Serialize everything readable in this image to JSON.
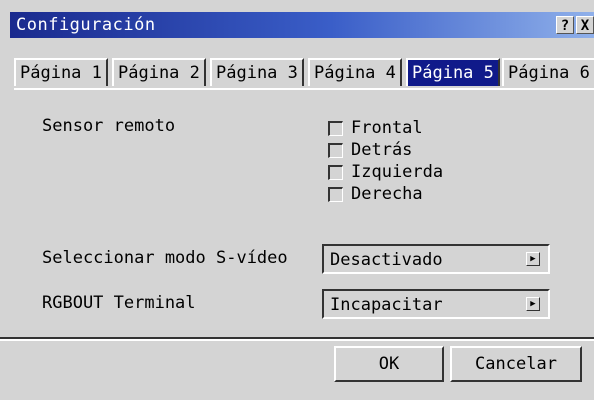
{
  "window": {
    "title": "Configuración",
    "help_icon": "?",
    "close_icon": "X"
  },
  "tabs": [
    {
      "label": "Página 1",
      "active": false
    },
    {
      "label": "Página 2",
      "active": false
    },
    {
      "label": "Página 3",
      "active": false
    },
    {
      "label": "Página 4",
      "active": false
    },
    {
      "label": "Página 5",
      "active": true
    },
    {
      "label": "Página 6",
      "active": false
    }
  ],
  "remote_sensor": {
    "label": "Sensor remoto",
    "options": [
      {
        "label": "Frontal",
        "checked": false
      },
      {
        "label": "Detrás",
        "checked": false
      },
      {
        "label": "Izquierda",
        "checked": false
      },
      {
        "label": "Derecha",
        "checked": false
      }
    ]
  },
  "svideo_mode": {
    "label": "Seleccionar modo S-vídeo",
    "value": "Desactivado"
  },
  "rgbout": {
    "label": "RGBOUT Terminal",
    "value": "Incapacitar"
  },
  "buttons": {
    "ok": "OK",
    "cancel": "Cancelar"
  },
  "colors": {
    "title_gradient_start": "#1a2a8e",
    "title_gradient_end": "#8fb0ea",
    "active_tab": "#101a8a",
    "face": "#d4d4d4"
  }
}
